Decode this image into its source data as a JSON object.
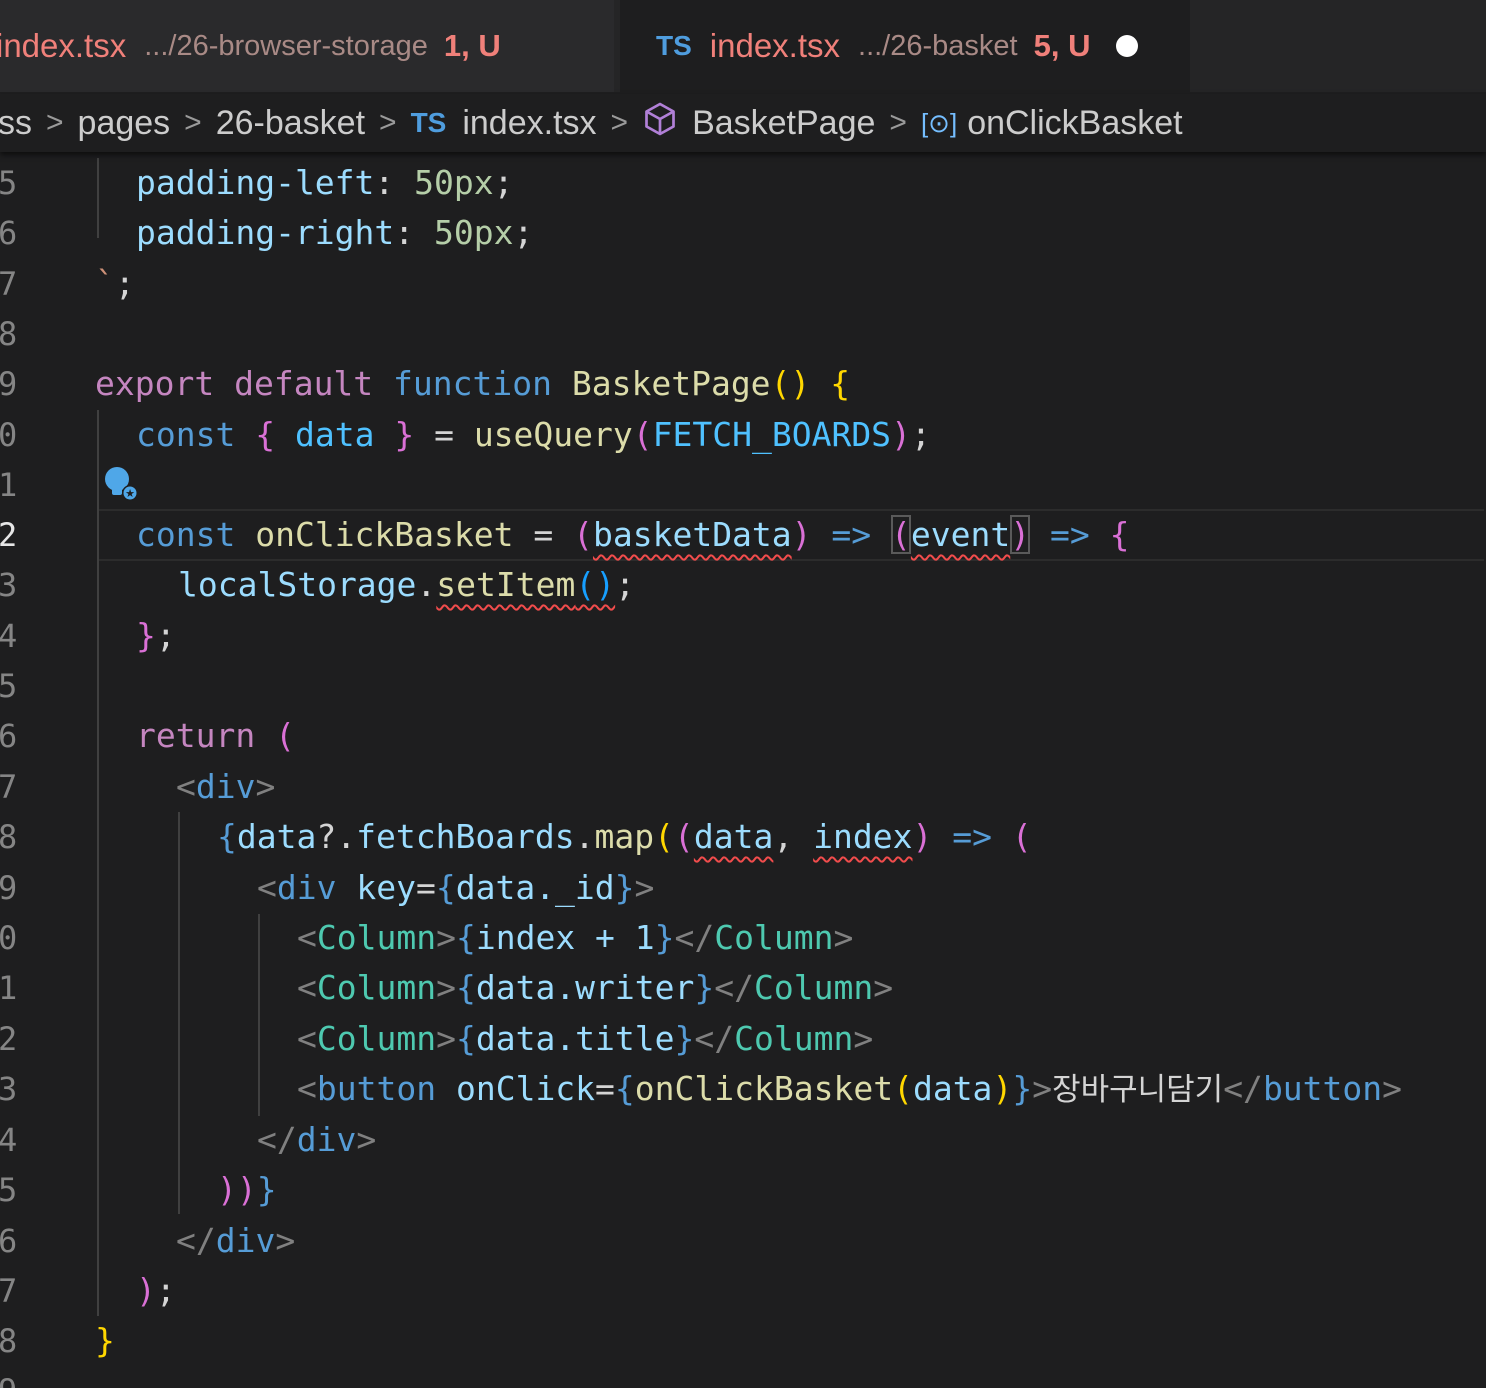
{
  "tabs": [
    {
      "lang": "",
      "file": "index.tsx",
      "path": ".../26-browser-storage",
      "status": "1, U"
    },
    {
      "lang": "TS",
      "file": "index.tsx",
      "path": ".../26-basket",
      "status": "5, U"
    }
  ],
  "breadcrumb": {
    "items": [
      "ss",
      "pages",
      "26-basket",
      "index.tsx",
      "BasketPage",
      "onClickBasket"
    ],
    "ts_badge": "TS",
    "var_badge": "[⊙]"
  },
  "colors": {
    "error": "#f14c4c",
    "ts_blue": "#4f9dde",
    "keyword": "#c586c0",
    "function": "#dcdcaa"
  },
  "line_numbers": [
    "5",
    "6",
    "7",
    "8",
    "9",
    "0",
    "1",
    "2",
    "3",
    "4",
    "5",
    "6",
    "7",
    "8",
    "9",
    "0",
    "1",
    "2",
    "3",
    "4",
    "5",
    "6",
    "7",
    "8",
    "9"
  ],
  "active_line_index": 7,
  "code": {
    "l5a": "padding-left",
    "l5b": ": ",
    "l5c": "50px",
    "l5d": ";",
    "l6a": "padding-right",
    "l6b": ": ",
    "l6c": "50px",
    "l6d": ";",
    "l7a": "`",
    "l7b": ";",
    "l9_export": "export",
    "l9_default": "default",
    "l9_function": "function",
    "l9_name": "BasketPage",
    "l9_paren": "()",
    "l9_brace": "{",
    "l10_const": "const",
    "l10_ob": "{",
    "l10_data": "data",
    "l10_cb": "}",
    "l10_eq": " = ",
    "l10_fn": "useQuery",
    "l10_po": "(",
    "l10_arg": "FETCH_BOARDS",
    "l10_pc": ")",
    "l10_semi": ";",
    "l12_const": "const",
    "l12_name": "onClickBasket",
    "l12_eq": " = ",
    "l12_po": "(",
    "l12_arg": "basketData",
    "l12_pc": ")",
    "l12_arrow": " => ",
    "l12_po2": "(",
    "l12_arg2": "event",
    "l12_pc2": ")",
    "l12_arrow2": " => ",
    "l12_brace": "{",
    "l13_obj": "localStorage",
    "l13_dot": ".",
    "l13_fn": "setItem",
    "l13_paren": "()",
    "l13_semi": ";",
    "l14_brace": "}",
    "l14_semi": ";",
    "l16_return": "return",
    "l16_paren": "(",
    "l17_lt": "<",
    "l17_tag": "div",
    "l17_gt": ">",
    "l18_ob": "{",
    "l18_data": "data",
    "l18_q": "?.",
    "l18_fb": "fetchBoards",
    "l18_dot": ".",
    "l18_map": "map",
    "l18_po": "(",
    "l18_po2": "(",
    "l18_arg1": "data",
    "l18_comma": ", ",
    "l18_arg2": "index",
    "l18_pc2": ")",
    "l18_arrow": " => ",
    "l18_po3": "(",
    "l19_lt": "<",
    "l19_tag": "div",
    "l19_key": "key",
    "l19_eq": "=",
    "l19_ob": "{",
    "l19_expr": "data._id",
    "l19_cb": "}",
    "l19_gt": ">",
    "col_open_lt": "<",
    "col_tag": "Column",
    "col_gt": ">",
    "col_close_lt": "</",
    "l20_ob": "{",
    "l20_expr": "index + 1",
    "l20_cb": "}",
    "l21_ob": "{",
    "l21_expr": "data.writer",
    "l21_cb": "}",
    "l22_ob": "{",
    "l22_expr": "data.title",
    "l22_cb": "}",
    "l23_lt": "<",
    "l23_tag": "button",
    "l23_attr": "onClick",
    "l23_eq": "=",
    "l23_ob": "{",
    "l23_fn": "onClickBasket",
    "l23_po": "(",
    "l23_arg": "data",
    "l23_pc": ")",
    "l23_cb": "}",
    "l23_gt": ">",
    "l23_text": "장바구니담기",
    "l23_close_lt": "</",
    "l23_close_gt": ">",
    "l24_lt": "</",
    "l24_tag": "div",
    "l24_gt": ">",
    "l25_close": "))",
    "l25_brace": "}",
    "l26_lt": "</",
    "l26_tag": "div",
    "l26_gt": ">",
    "l27_paren": ")",
    "l27_semi": ";",
    "l28_brace": "}"
  }
}
